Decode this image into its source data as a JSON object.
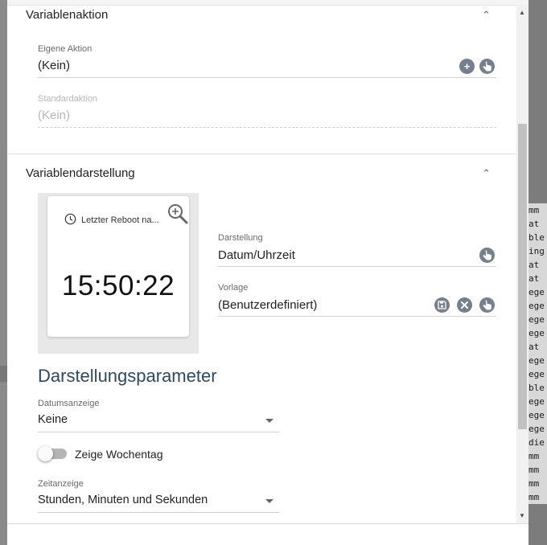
{
  "background_text": [
    "mm",
    "at",
    "ble",
    "ing",
    "at",
    "at",
    "ege",
    "ege",
    "ege",
    "ege",
    "at",
    "ege",
    "ege",
    "ble",
    "ege",
    "ege",
    "ege",
    "die",
    "mm",
    "mm",
    "mm",
    "mm"
  ],
  "sections": {
    "action": {
      "title": "Variablenaktion",
      "custom_label": "Eigene Aktion",
      "custom_value": "(Kein)",
      "default_label": "Standardaktion",
      "default_value": "(Kein)"
    },
    "display": {
      "title": "Variablendarstellung",
      "tile": {
        "title": "Letzter Reboot na...",
        "time": "15:50:22"
      },
      "presentation_label": "Darstellung",
      "presentation_value": "Datum/Uhrzeit",
      "template_label": "Vorlage",
      "template_value": "(Benutzerdefiniert)"
    }
  },
  "params": {
    "heading": "Darstellungsparameter",
    "date_label": "Datumsanzeige",
    "date_value": "Keine",
    "weekday_label": "Zeige Wochentag",
    "weekday_enabled": false,
    "time_label": "Zeitanzeige",
    "time_value": "Stunden, Minuten und Sekunden"
  },
  "icons": {
    "collapse": "chevron-up-icon",
    "add": "plus-icon",
    "pointer": "hand-pointer-icon",
    "save": "save-icon",
    "clear": "close-icon",
    "clock": "clock-icon",
    "zoom": "zoom-in-icon",
    "dropdown": "caret-down-icon"
  },
  "colors": {
    "icon_button": "#75808c",
    "heading": "#2b4a63",
    "scroll_thumb": "#c1c1c1"
  }
}
